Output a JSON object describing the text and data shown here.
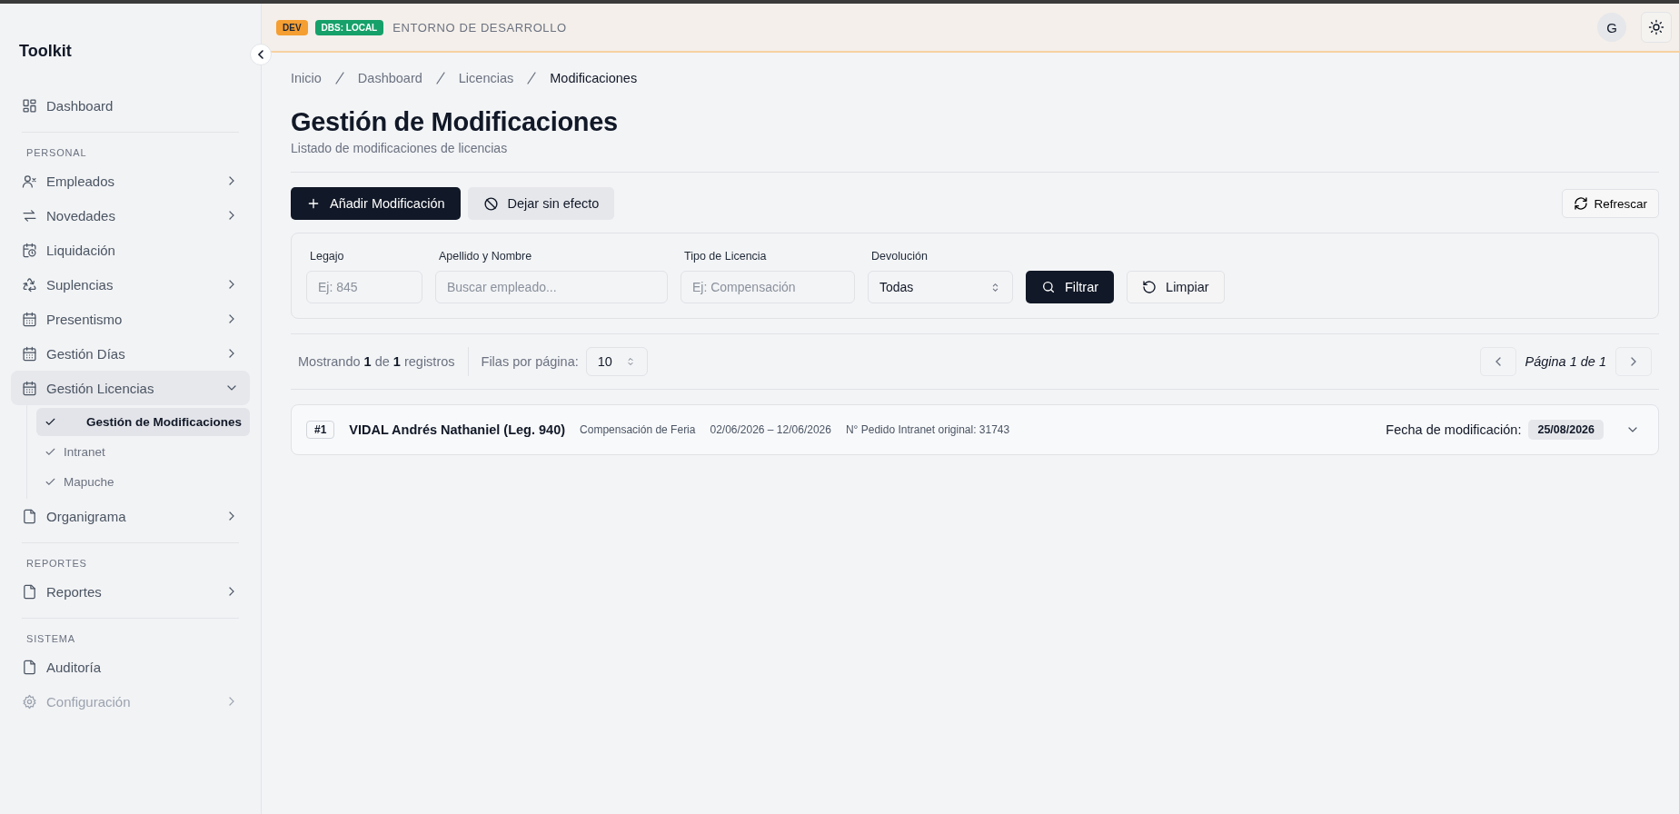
{
  "sidebar": {
    "title": "Toolkit",
    "groups": [
      {
        "items": [
          {
            "kind": "grid",
            "label": "Dashboard",
            "submenu": false,
            "disabled": false
          }
        ]
      },
      {
        "heading": "PERSONAL",
        "items": [
          {
            "kind": "users",
            "label": "Empleados",
            "submenu": true,
            "expanded": false,
            "disabled": false
          },
          {
            "kind": "arrows",
            "label": "Novedades",
            "submenu": true,
            "expanded": false,
            "disabled": false
          },
          {
            "kind": "calendar-clock",
            "label": "Liquidación",
            "submenu": false,
            "disabled": false
          },
          {
            "kind": "recycle",
            "label": "Suplencias",
            "submenu": true,
            "expanded": false,
            "disabled": false
          },
          {
            "kind": "calendar",
            "label": "Presentismo",
            "submenu": true,
            "expanded": false,
            "disabled": false
          },
          {
            "kind": "calendar",
            "label": "Gestión Días",
            "submenu": true,
            "expanded": false,
            "disabled": false
          },
          {
            "kind": "calendar",
            "label": "Gestión Licencias",
            "submenu": true,
            "expanded": true,
            "disabled": false,
            "children": [
              {
                "label": "Gestión de Modificaciones",
                "selected": true
              },
              {
                "label": "Intranet",
                "selected": false
              },
              {
                "label": "Mapuche",
                "selected": false
              }
            ]
          },
          {
            "kind": "file",
            "label": "Organigrama",
            "submenu": true,
            "expanded": false,
            "disabled": false
          }
        ]
      },
      {
        "heading": "REPORTES",
        "items": [
          {
            "kind": "file",
            "label": "Reportes",
            "submenu": true,
            "expanded": false,
            "disabled": false
          }
        ]
      },
      {
        "heading": "SISTEMA",
        "items": [
          {
            "kind": "file",
            "label": "Auditoría",
            "submenu": false,
            "disabled": false
          },
          {
            "kind": "gear",
            "label": "Configuración",
            "submenu": true,
            "expanded": false,
            "disabled": true
          }
        ]
      }
    ]
  },
  "topbar": {
    "badges": [
      {
        "label": "DEV",
        "color": "#f59e32"
      },
      {
        "label": "DBS: LOCAL",
        "color": "#16a06a"
      }
    ],
    "environment": "ENTORNO DE DESARROLLO",
    "avatar": "G"
  },
  "breadcrumbs": [
    "Inicio",
    "Dashboard",
    "Licencias",
    "Modificaciones"
  ],
  "page": {
    "title": "Gestión de Modificaciones",
    "subtitle": "Listado de modificaciones de licencias"
  },
  "actions": [
    {
      "kind": "primary",
      "label": "Añadir Modificación"
    },
    {
      "kind": "secondary",
      "label": "Dejar sin efecto"
    }
  ],
  "refresh_button": "Refrescar",
  "filters": [
    {
      "kind": "text",
      "label": "Legajo",
      "placeholder": "Ej: 845"
    },
    {
      "kind": "text",
      "label": "Apellido y Nombre",
      "placeholder": "Buscar empleado..."
    },
    {
      "kind": "text",
      "label": "Tipo de Licencia",
      "placeholder": "Ej: Compensación"
    },
    {
      "kind": "select",
      "label": "Devolución",
      "value": "Todas"
    }
  ],
  "filter_buttons": [
    {
      "kind": "primary",
      "label": "Filtrar"
    },
    {
      "kind": "secondary",
      "label": "Limpiar"
    }
  ],
  "summary": "Mostrando **1** de **1** registros",
  "rows_per_page": {
    "label": "Filas por página:",
    "value": "10"
  },
  "pagination": "Página 1 de 1",
  "records": [
    {
      "index": "#1",
      "name": "VIDAL Andrés Nathaniel (Leg. 940)",
      "type": "Compensación de Feria",
      "dates": "02/06/2026 – 12/06/2026",
      "order": "N° Pedido Intranet original: 31743",
      "date_label": "Fecha de modificación:",
      "date": "25/08/2026",
      "expanded": false
    }
  ]
}
